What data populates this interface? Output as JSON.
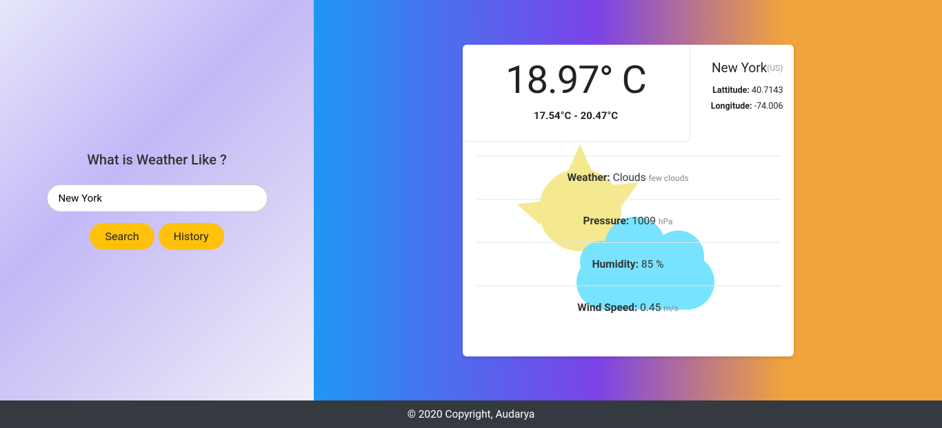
{
  "search": {
    "title": "What is Weather Like ?",
    "input_value": "New York",
    "placeholder": "",
    "search_label": "Search",
    "history_label": "History"
  },
  "weather": {
    "temp": "18.97° C",
    "range": "17.54°C - 20.47°C",
    "city": "New York",
    "country": "(US)",
    "lat_label": "Lattitude:",
    "lat_value": " 40.7143",
    "lon_label": "Longitude:",
    "lon_value": " -74.006",
    "weather_label": "Weather:",
    "weather_value": " Clouds ",
    "weather_desc": "few clouds",
    "pressure_label": "Pressure:",
    "pressure_value": " 1009 ",
    "pressure_unit": "hPa",
    "humidity_label": "Humidity:",
    "humidity_value": " 85 %",
    "wind_label": "Wind Speed:",
    "wind_value": " 0.45 ",
    "wind_unit": "m/s"
  },
  "footer": {
    "text": "© 2020 Copyright, Audarya"
  }
}
